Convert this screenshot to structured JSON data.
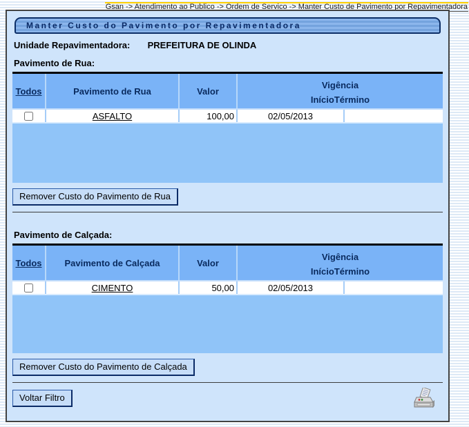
{
  "breadcrumb": "Gsan -> Atendimento ao Publico -> Ordem de Servico -> Manter Custo de Pavimento por Repavimentadora",
  "page_title": "Manter Custo do Pavimento por Repavimentadora",
  "unit": {
    "label": "Unidade Repavimentadora:",
    "value": "PREFEITURA DE OLINDA"
  },
  "street": {
    "label": "Pavimento de Rua:",
    "table": {
      "headers": {
        "select_all": "Todos",
        "name": "Pavimento de Rua",
        "value": "Valor",
        "validity": "Vigência",
        "start": "Início",
        "end": "Término"
      },
      "rows": [
        {
          "name": "ASFALTO",
          "value": "100,00",
          "start": "02/05/2013",
          "end": ""
        }
      ]
    },
    "remove_button": "Remover Custo do Pavimento de Rua"
  },
  "sidewalk": {
    "label": "Pavimento de Calçada:",
    "table": {
      "headers": {
        "select_all": "Todos",
        "name": "Pavimento de Calçada",
        "value": "Valor",
        "validity": "Vigência",
        "start": "Início",
        "end": "Término"
      },
      "rows": [
        {
          "name": "CIMENTO",
          "value": "50,00",
          "start": "02/05/2013",
          "end": ""
        }
      ]
    },
    "remove_button": "Remover Custo do Pavimento de Calçada"
  },
  "footer": {
    "back_button": "Voltar Filtro",
    "print_icon": "printer-icon"
  },
  "colors": {
    "accent_header_blue": "#7ab3f7",
    "table_body_blue": "#90c4f8",
    "panel_blue": "#cfe4fb",
    "title_border_navy": "#0b2d66",
    "breadcrumb_yellow": "#ffcf00"
  }
}
